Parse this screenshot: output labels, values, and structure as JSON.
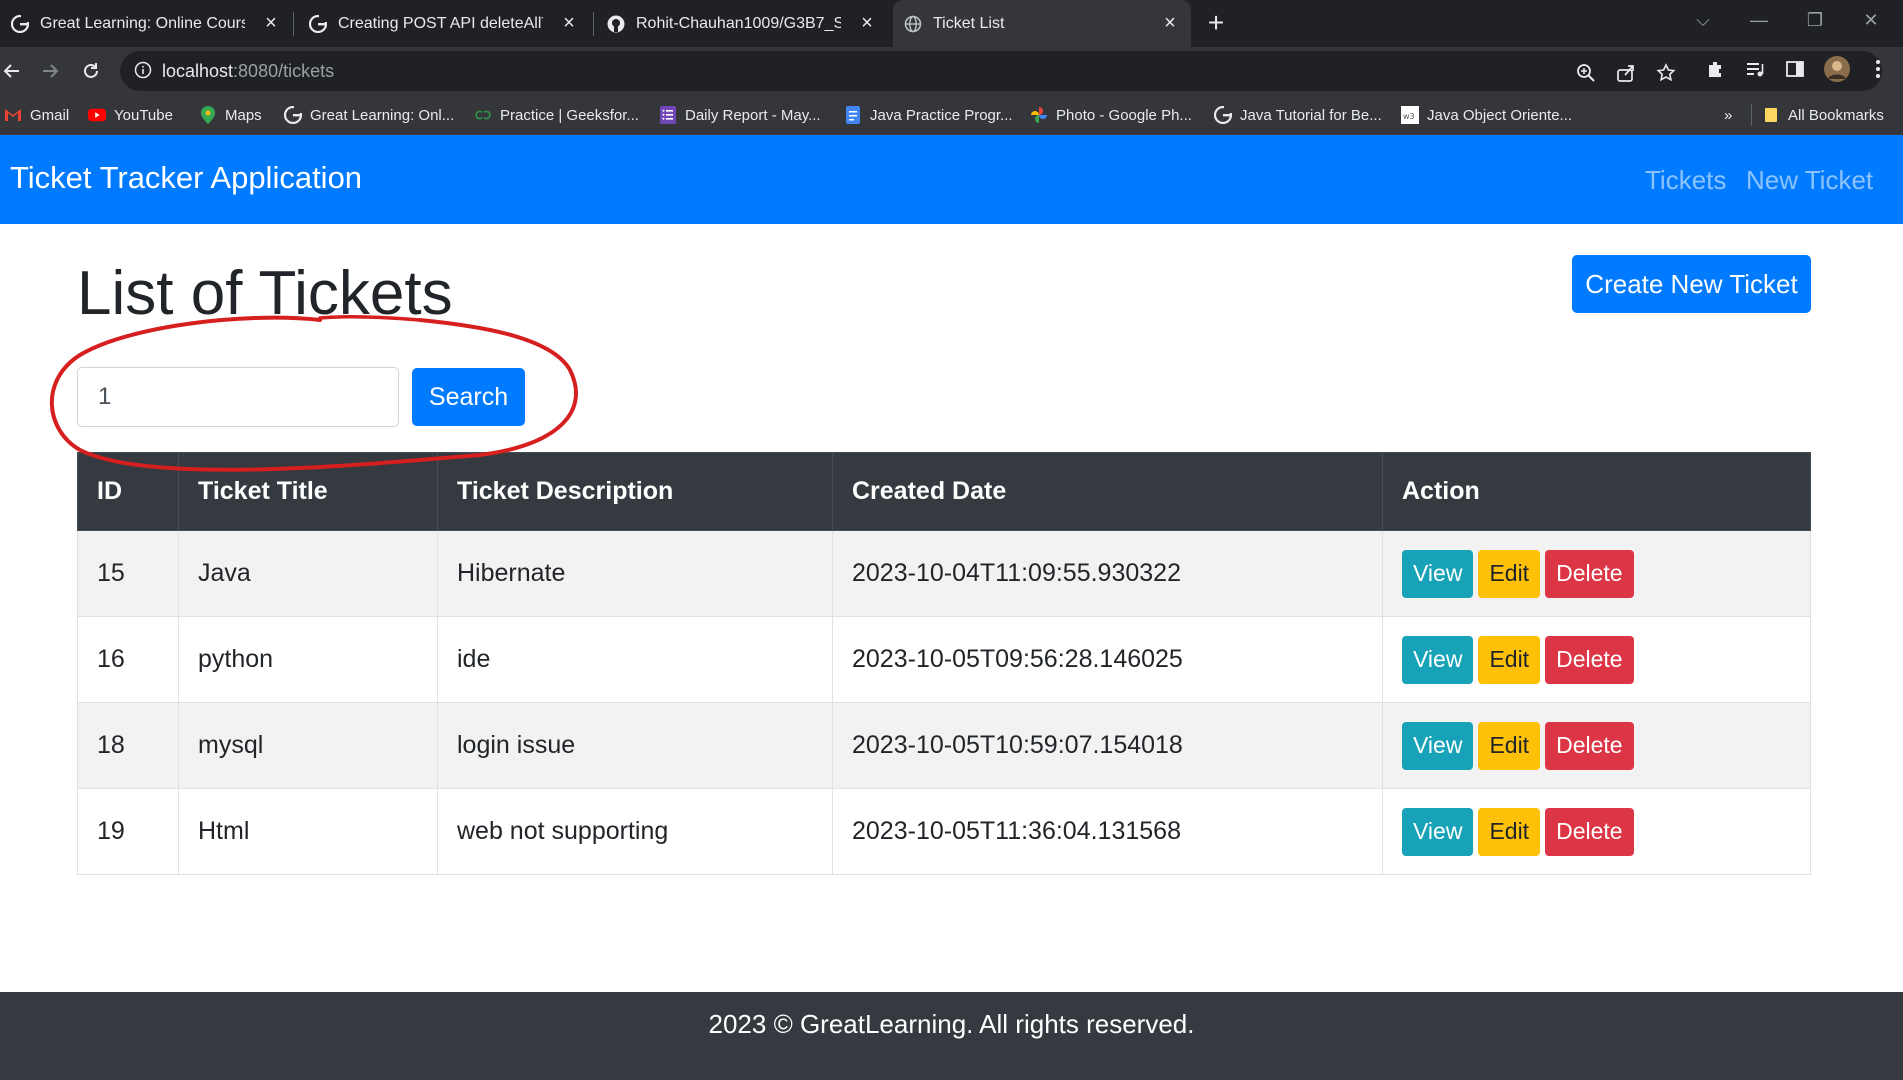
{
  "browser": {
    "tabs": [
      {
        "title": "Great Learning: Online Courses,",
        "icon": "google-g"
      },
      {
        "title": "Creating POST API deleteAllThes",
        "icon": "google-g"
      },
      {
        "title": "Rohit-Chauhan1009/G3B7_Sprin",
        "icon": "github"
      },
      {
        "title": "Ticket List",
        "icon": "globe"
      }
    ],
    "url_host": "localhost",
    "url_path": ":8080/tickets",
    "bookmarks": [
      {
        "label": "Gmail",
        "icon": "gmail"
      },
      {
        "label": "YouTube",
        "icon": "youtube"
      },
      {
        "label": "Maps",
        "icon": "maps"
      },
      {
        "label": "Great Learning: Onl...",
        "icon": "google-g"
      },
      {
        "label": "Practice | Geeksfor...",
        "icon": "geeksforgeeks"
      },
      {
        "label": "Daily Report - May...",
        "icon": "forms"
      },
      {
        "label": "Java Practice Progr...",
        "icon": "docs"
      },
      {
        "label": "Photo - Google Ph...",
        "icon": "photos"
      },
      {
        "label": "Java Tutorial for Be...",
        "icon": "google-g"
      },
      {
        "label": "Java Object Oriente...",
        "icon": "w3schools"
      }
    ],
    "bookmarks_overflow": "»",
    "all_bookmarks": "All Bookmarks"
  },
  "navbar": {
    "brand": "Ticket Tracker Application",
    "links": [
      "Tickets",
      "New Ticket"
    ]
  },
  "page": {
    "title": "List of Tickets",
    "create_button": "Create New Ticket",
    "search_value": "1",
    "search_button": "Search"
  },
  "table": {
    "headers": [
      "ID",
      "Ticket Title",
      "Ticket Description",
      "Created Date",
      "Action"
    ],
    "rows": [
      {
        "id": "15",
        "title": "Java",
        "description": "Hibernate",
        "created": "2023-10-04T11:09:55.930322"
      },
      {
        "id": "16",
        "title": "python",
        "description": "ide",
        "created": "2023-10-05T09:56:28.146025"
      },
      {
        "id": "18",
        "title": "mysql",
        "description": "login issue",
        "created": "2023-10-05T10:59:07.154018"
      },
      {
        "id": "19",
        "title": "Html",
        "description": "web not supporting",
        "created": "2023-10-05T11:36:04.131568"
      }
    ],
    "actions": {
      "view": "View",
      "edit": "Edit",
      "delete": "Delete"
    }
  },
  "footer": "2023 © GreatLearning. All rights reserved.",
  "colors": {
    "primary": "#007bff",
    "dark": "#343a40",
    "info": "#17a2b8",
    "warning": "#ffc107",
    "danger": "#dc3545",
    "annotation": "#d61f1f"
  }
}
